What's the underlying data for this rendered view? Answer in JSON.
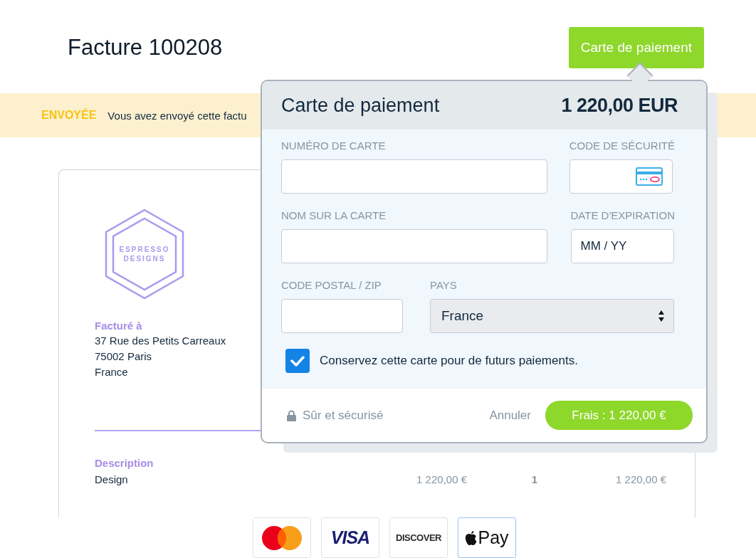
{
  "header": {
    "title": "Facture 100208",
    "pay_button": "Carte de paiement"
  },
  "banner": {
    "status": "ENVOYÉE",
    "message": "Vous avez envoyé cette factu"
  },
  "invoice": {
    "logo_lines": [
      "ESPRESSO",
      "DESIGNS"
    ],
    "billed_to_label": "Facturé à",
    "address": [
      "37 Rue des Petits Carreaux",
      "75002 Paris",
      "France"
    ],
    "description_label": "Description",
    "line_items": [
      {
        "description": "Design",
        "unit_price": "1 220,00 €",
        "quantity": "1",
        "total": "1 220,00 €"
      }
    ]
  },
  "popover": {
    "title": "Carte de paiement",
    "amount": "1 220,00 EUR",
    "fields": [
      {
        "label": "NUMÉRO DE CARTE",
        "kind": "text"
      },
      {
        "label": "CODE DE SÉCURITÉ",
        "kind": "cvc"
      },
      {
        "label": "NOM SUR LA CARTE",
        "kind": "text"
      },
      {
        "label": "DATE D'EXPIRATION",
        "kind": "text",
        "placeholder": "MM / YY"
      },
      {
        "label": "CODE POSTAL / ZIP",
        "kind": "text"
      },
      {
        "label": "PAYS",
        "kind": "select",
        "value": "France"
      }
    ],
    "save_card": {
      "label": "Conservez cette carte pour de futurs paiements.",
      "checked": true
    },
    "secure_note": "Sûr et sécurisé",
    "cancel": "Annuler",
    "submit": "Frais : 1 220,00 €"
  },
  "payment_methods": [
    {
      "kind": "mastercard",
      "selected": false
    },
    {
      "kind": "visa",
      "label": "VISA",
      "selected": false
    },
    {
      "kind": "discover",
      "label": "DISCOVER",
      "selected": false
    },
    {
      "kind": "applepay",
      "label": "Pay",
      "selected": true
    }
  ]
}
